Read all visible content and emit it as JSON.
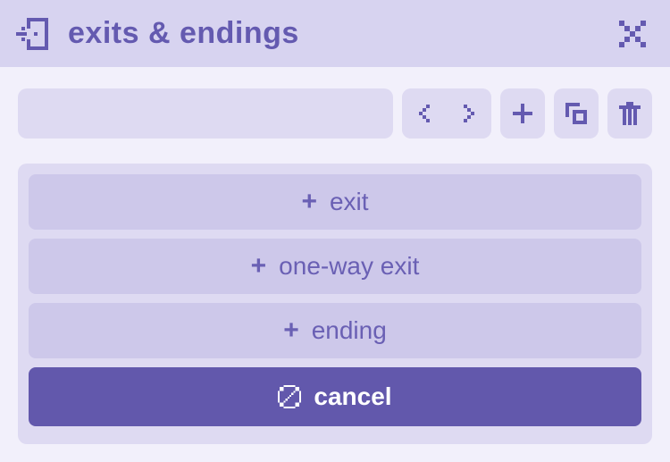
{
  "colors": {
    "bg": "#f2f0fb",
    "header_bg": "#d7d3f0",
    "panel_bg": "#dedaf2",
    "button_bg": "#cdc8ea",
    "accent": "#6258ac",
    "text": "#645ab0"
  },
  "header": {
    "title": "exits & endings",
    "icon_name": "exit-door-icon",
    "close_name": "close-icon"
  },
  "toolbar": {
    "name_value": "",
    "name_placeholder": "",
    "prev_name": "arrow-left-icon",
    "next_name": "arrow-right-icon",
    "add_name": "plus-icon",
    "duplicate_name": "duplicate-icon",
    "delete_name": "trash-icon"
  },
  "actions": {
    "exit": {
      "label": "exit",
      "glyph": "+"
    },
    "one_way": {
      "label": "one-way exit",
      "glyph": "+"
    },
    "ending": {
      "label": "ending",
      "glyph": "+"
    },
    "cancel": {
      "label": "cancel",
      "icon_name": "cancel-icon"
    }
  }
}
